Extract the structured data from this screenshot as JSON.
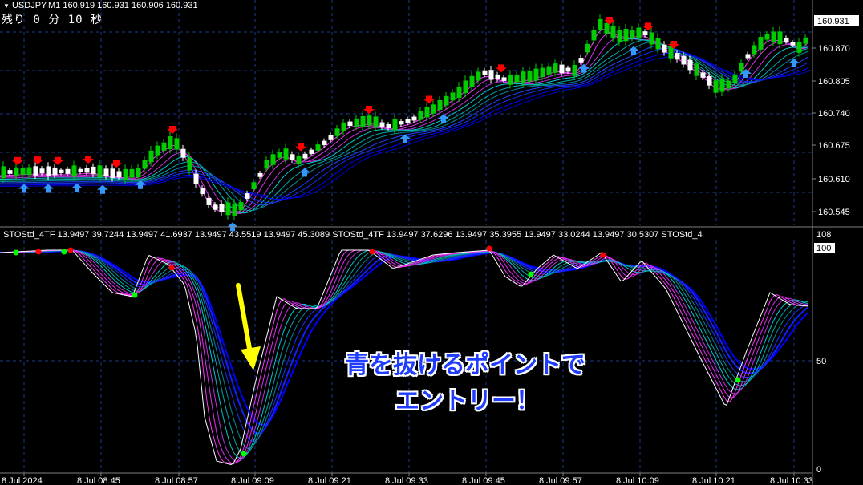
{
  "header": {
    "symbol_line": "USDJPY,M1  160.919 160.931 160.906 160.931",
    "timer": "残り 0 分 10 秒"
  },
  "price_axis": {
    "current_price": "160.931",
    "ticks": [
      "160.870",
      "160.805",
      "160.740",
      "160.675",
      "160.610",
      "160.545"
    ]
  },
  "sub_window": {
    "indicator_line": "STOStd_4TF 13.9497 39.7244 13.9497 41.6937 13.9497 43.5519 13.9497 45.3089  STOStd_4TF 13.9497 37.6296 13.9497 35.3955 13.9497 33.0244 13.9497 30.5307  STOStd_4",
    "max_label": "108",
    "top_label": "100",
    "mid_label": "50",
    "bottom_label": "0"
  },
  "time_axis": {
    "labels": [
      "8 Jul 2024",
      "8 Jul 08:45",
      "8 Jul 08:57",
      "8 Jul 09:09",
      "8 Jul 09:21",
      "8 Jul 09:33",
      "8 Jul 09:45",
      "8 Jul 09:57",
      "8 Jul 10:09",
      "8 Jul 10:21",
      "8 Jul 10:33"
    ]
  },
  "annotation": {
    "line1": "青を抜けるポイントで",
    "line2": "エントリー！"
  },
  "colors": {
    "background": "#000000",
    "grid": "#1c3a8c",
    "bull_candle": "#00cc00",
    "bear_candle": "#ffffff",
    "ma_fast": "#ff33ff",
    "ma_mid": "#00cccc",
    "ma_slow": "#0000ff",
    "arrow_up": "#3399ff",
    "arrow_down": "#ff0000",
    "annotation_arrow": "#ffff00",
    "annotation_text": "#1f3cff"
  }
}
